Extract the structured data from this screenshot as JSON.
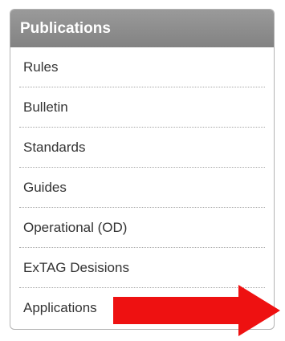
{
  "panel": {
    "title": "Publications",
    "items": [
      {
        "label": "Rules"
      },
      {
        "label": "Bulletin"
      },
      {
        "label": "Standards"
      },
      {
        "label": "Guides"
      },
      {
        "label": "Operational (OD)"
      },
      {
        "label": "ExTAG Desisions"
      },
      {
        "label": "Applications"
      }
    ]
  },
  "annotation": {
    "arrow_color": "#ee1111",
    "icon": "red-right-arrow"
  }
}
